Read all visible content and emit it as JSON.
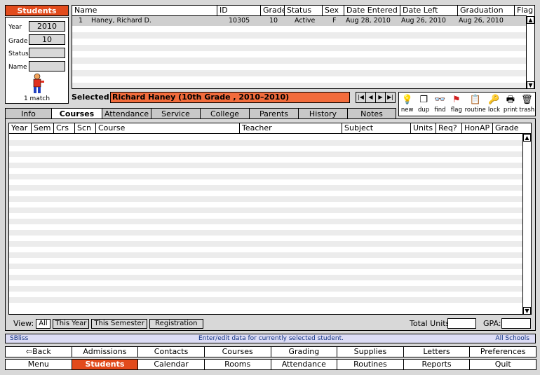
{
  "left": {
    "title": "Students",
    "year_label": "Year",
    "year_value": "2010",
    "grade_label": "Grade",
    "grade_value": "10",
    "status_label": "Status",
    "status_value": "",
    "name_label": "Name",
    "name_value": "",
    "match_text": "1 match"
  },
  "top_table": {
    "headers": [
      "Name",
      "ID",
      "Grade",
      "Status",
      "Sex",
      "Date Entered",
      "Date Left",
      "Graduation",
      "Flag"
    ],
    "row": {
      "num": "1",
      "name": "Haney, Richard D.",
      "id": "10305",
      "grade": "10",
      "status": "Active",
      "sex": "F",
      "entered": "Aug 28, 2010",
      "left": "Aug 26, 2010",
      "graduation": "Aug 26, 2010"
    }
  },
  "selected": {
    "label": "Selected:",
    "value": "Richard Haney (10th Grade , 2010–2010)"
  },
  "toolbar": [
    "new",
    "dup",
    "find",
    "flag",
    "routine",
    "lock",
    "print",
    "trash"
  ],
  "tabs": [
    "Info",
    "Courses",
    "Attendance",
    "Service",
    "College",
    "Parents",
    "History",
    "Notes"
  ],
  "active_tab": "Courses",
  "grid_headers": [
    "Year",
    "Sem",
    "Crs",
    "Scn",
    "Course",
    "Teacher",
    "Subject",
    "Units",
    "Req?",
    "HonAP",
    "Grade"
  ],
  "view": {
    "label": "View:",
    "buttons": [
      "All",
      "This Year",
      "This Semester",
      "Registration"
    ],
    "selected": "All"
  },
  "totals": {
    "units_label": "Total Units:",
    "gpa_label": "GPA:"
  },
  "status_bar": {
    "left": "SBliss",
    "middle": "Enter/edit data for currently selected student.",
    "right": "All Schools"
  },
  "nav_row1": [
    "Back",
    "Admissions",
    "Contacts",
    "Courses",
    "Grading",
    "Supplies",
    "Letters",
    "Preferences"
  ],
  "nav_row2": [
    "Menu",
    "Students",
    "Calendar",
    "Rooms",
    "Attendance",
    "Routines",
    "Reports",
    "Quit"
  ],
  "colors": {
    "accent": "#e24b1c",
    "selected_field": "#f26c3c",
    "status_bg": "#dcdcf5"
  }
}
